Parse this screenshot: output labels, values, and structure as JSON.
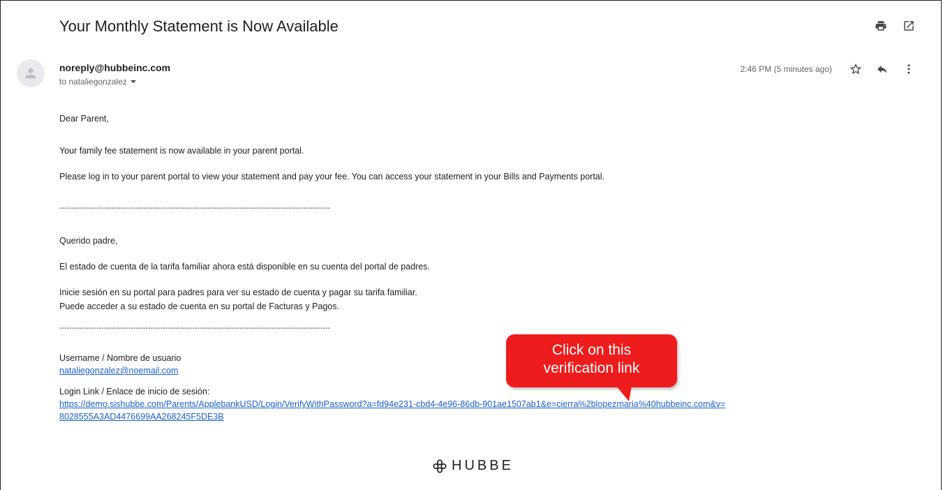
{
  "email": {
    "subject": "Your Monthly Statement is Now Available",
    "sender": "noreply@hubbeinc.com",
    "recipient": "to nataliegonzalez",
    "time": "2:46 PM (5 minutes ago)"
  },
  "icons": {
    "print": "print-icon",
    "open_new_window": "open-in-new-icon",
    "star": "star-icon",
    "reply": "reply-icon",
    "more": "more-vert-icon",
    "avatar": "person-icon",
    "recipient_dropdown": "caret-down-icon"
  },
  "body": {
    "greeting_en": "Dear Parent,",
    "line1_en": "Your family fee statement is now available in your parent portal.",
    "line2_en": "Please log in to your parent portal to view your statement and pay your fee. You can access your statement in your Bills and Payments portal.",
    "divider": "--------------------------------------------------------------------------------------------------------------",
    "greeting_es": "Querido padre,",
    "line1_es": "El estado de cuenta de la tarifa familiar ahora está disponible en su cuenta del portal de padres.",
    "line2_es": "Inicie sesión en su portal para padres para ver su estado de cuenta y pagar su tarifa familiar.",
    "line3_es": "Puede acceder a su estado de cuenta en su portal de Facturas y Pagos.",
    "username_label": "Username / Nombre de usuario",
    "username_value": "nataliegonzalez@noemail.com",
    "login_label": "Login Link / Enlace de inicio de sesión:",
    "login_link_line1": "https://demo.sishubbe.com/Parents/ApplebankUSD/Login/VerifyWithPassword?a=fd94e231-cbd4-4e96-86db-901ae1507ab1&e=cierra%2blopezmaria%40hubbeinc.com&v=",
    "login_link_line2": "8028555A3AD4476699AA268245F5DE3B"
  },
  "callout": {
    "line1": "Click on this",
    "line2": "verification link",
    "color": "#ee1c1c"
  },
  "footer": {
    "logo_text": "HUBBE"
  }
}
